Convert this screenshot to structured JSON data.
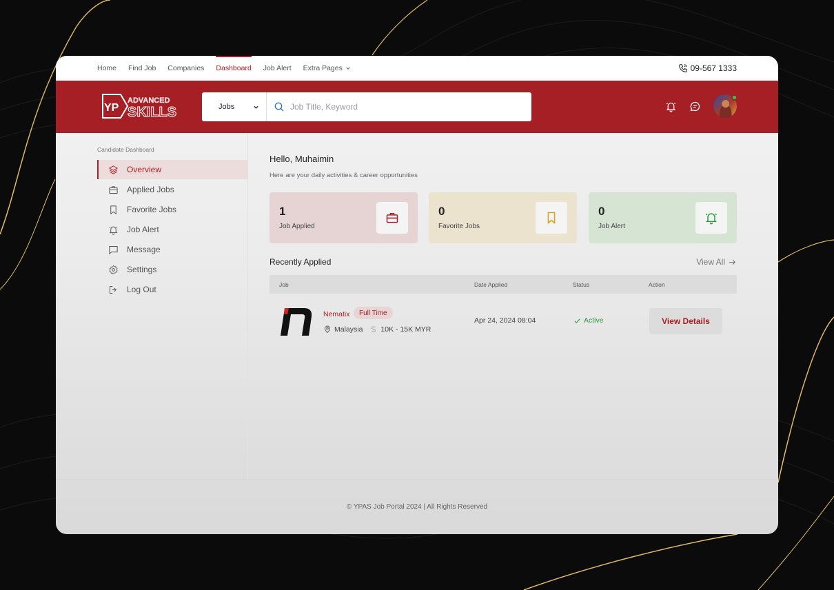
{
  "topnav": {
    "links": [
      "Home",
      "Find Job",
      "Companies",
      "Dashboard",
      "Job Alert",
      "Extra Pages"
    ],
    "active": "Dashboard",
    "phone": "09-567 1333"
  },
  "header": {
    "logo_text_top": "ADVANCED",
    "logo_text_bottom": "SKILLS",
    "logo_mark": "YP",
    "search_category": "Jobs",
    "search_placeholder": "Job Title, Keyword"
  },
  "sidebar": {
    "caption": "Candidate Dashboard",
    "items": [
      {
        "label": "Overview",
        "icon": "layers-icon"
      },
      {
        "label": "Applied Jobs",
        "icon": "briefcase-icon"
      },
      {
        "label": "Favorite Jobs",
        "icon": "bookmark-icon"
      },
      {
        "label": "Job Alert",
        "icon": "bell-icon"
      },
      {
        "label": "Message",
        "icon": "message-icon"
      },
      {
        "label": "Settings",
        "icon": "gear-icon"
      },
      {
        "label": "Log Out",
        "icon": "logout-icon"
      }
    ]
  },
  "dashboard": {
    "greeting": "Hello, Muhaimin",
    "subtitle": "Here are your daily activities & career opportunities",
    "stats": [
      {
        "value": "1",
        "label": "Job Applied"
      },
      {
        "value": "0",
        "label": "Favorite Jobs"
      },
      {
        "value": "0",
        "label": "Job Alert"
      }
    ],
    "recent_title": "Recently Applied",
    "view_all": "View All",
    "columns": [
      "Job",
      "Date Applied",
      "Status",
      "Action"
    ],
    "applications": [
      {
        "company": "Nematix",
        "type": "Full Time",
        "location": "Malaysia",
        "salary": "10K - 15K MYR",
        "date": "Apr 24, 2024 08:04",
        "status": "Active",
        "action": "View Details"
      }
    ]
  },
  "footer": "© YPAS Job Portal 2024 | All Rights Reserved",
  "colors": {
    "brand": "#a51f24",
    "active_status": "#2e9a3f",
    "favorite_accent": "#d9a21b",
    "alert_accent": "#2e9a3f"
  }
}
